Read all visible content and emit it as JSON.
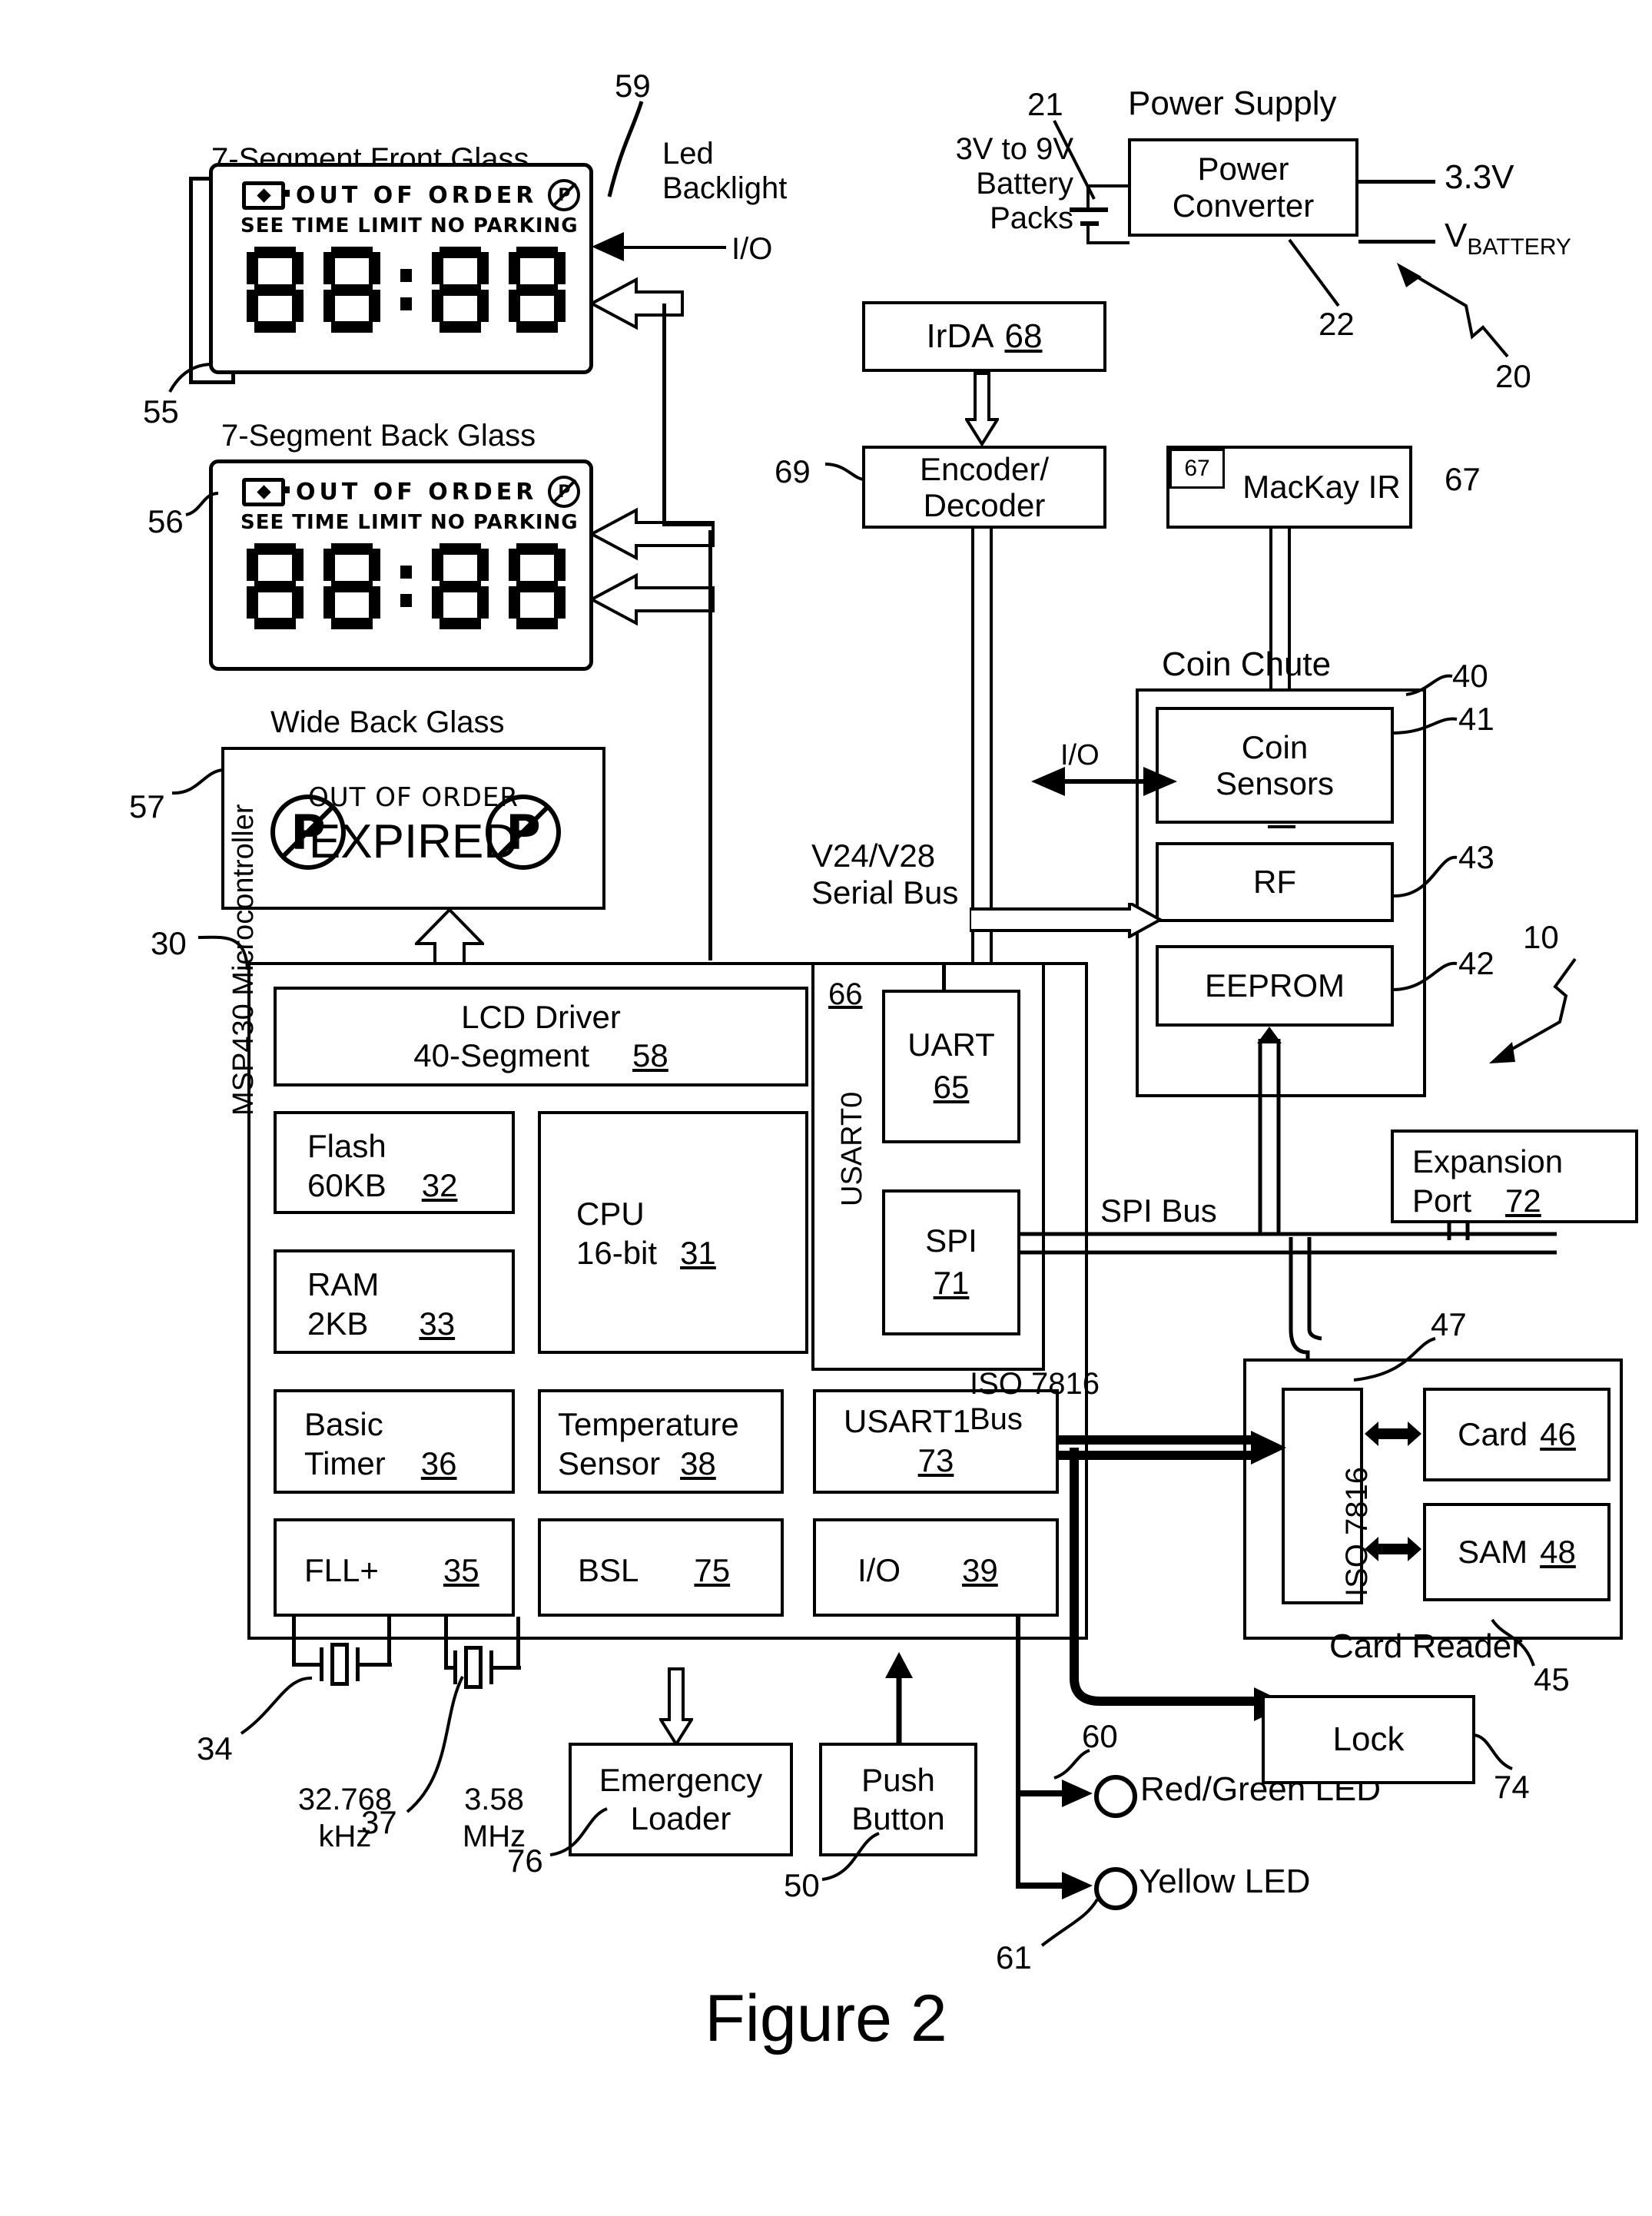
{
  "figure": {
    "caption": "Figure 2"
  },
  "displays": {
    "front_glass": {
      "title": "7-Segment Front Glass",
      "ref": "55",
      "line1": "OUT OF ORDER",
      "line2": "SEE TIME LIMIT   NO PARKING",
      "digits": "88:88",
      "battery_icon": "battery-icon",
      "no_parking_icon": "no-parking-icon"
    },
    "back_glass": {
      "title": "7-Segment Back Glass",
      "ref": "56",
      "line1": "OUT OF ORDER",
      "line2": "SEE TIME LIMIT   NO PARKING",
      "digits": "88:88"
    },
    "wide_back_glass": {
      "title": "Wide Back Glass",
      "ref": "57",
      "line1": "OUT OF ORDER",
      "line2": "EXPIRED"
    },
    "backlight": {
      "label": "Led\nBacklight",
      "ref": "59",
      "io": "I/O"
    }
  },
  "power": {
    "title": "Power Supply",
    "converter": "Power\nConverter",
    "battery_label": "3V to 9V\nBattery\nPacks",
    "battery_ref": "21",
    "converter_ref": "22",
    "system_ref": "20",
    "out1": "3.3V",
    "out2_v": "V",
    "out2_sub": "BATTERY"
  },
  "ir": {
    "irda": "IrDA",
    "irda_ref": "68",
    "encdec": "Encoder/\nDecoder",
    "encdec_ref": "69",
    "mackay": "MacKay IR",
    "mackay_ref_inner": "67",
    "mackay_ref_outer": "67"
  },
  "coin_chute": {
    "title": "Coin Chute",
    "ref": "40",
    "io": "I/O",
    "items": [
      {
        "label": "Coin\nSensors",
        "ref": "41"
      },
      {
        "label": "RF",
        "ref": "43"
      },
      {
        "label": "EEPROM",
        "ref": "42"
      }
    ],
    "system_ref": "10"
  },
  "buses": {
    "serial": "V24/V28\nSerial Bus",
    "spi": "SPI Bus",
    "iso": "ISO 7816\nBus"
  },
  "mcu": {
    "side_label": "MSP430 Microcontroller",
    "ref": "30",
    "lcd_driver": {
      "line1": "LCD Driver",
      "line2": "40-Segment",
      "ref": "58"
    },
    "blocks": [
      {
        "line1": "Flash",
        "line2": "60KB",
        "ref": "32"
      },
      {
        "line1": "CPU",
        "line2": "16-bit",
        "ref": "31"
      },
      {
        "line1": "RAM",
        "line2": "2KB",
        "ref": "33"
      },
      {
        "line1": "Basic",
        "line2": "Timer",
        "ref": "36"
      },
      {
        "line1": "Temperature",
        "line2": "Sensor",
        "ref": "38"
      },
      {
        "line1": "FLL+",
        "line2": "",
        "ref": "35"
      },
      {
        "line1": "BSL",
        "line2": "",
        "ref": "75"
      },
      {
        "line1": "I/O",
        "line2": "",
        "ref": "39"
      },
      {
        "line1": "USART1",
        "line2": "",
        "ref": "73"
      }
    ],
    "usart0": {
      "label": "USART0",
      "ref": "66",
      "uart": {
        "label": "UART",
        "ref": "65"
      },
      "spi": {
        "label": "SPI",
        "ref": "71"
      }
    }
  },
  "expansion": {
    "line1": "Expansion",
    "line2": "Port",
    "ref": "72"
  },
  "card_reader": {
    "title": "Card Reader",
    "ref": "45",
    "iso_label": "ISO 7816",
    "iso_ref": "47",
    "card": "Card",
    "card_ref": "46",
    "sam": "SAM",
    "sam_ref": "48"
  },
  "clocks": [
    {
      "line1": "32.768",
      "line2": "kHz",
      "ref": "34"
    },
    {
      "line1": "3.58",
      "line2": "MHz",
      "ref": "37"
    }
  ],
  "bottom": {
    "emergency_loader": "Emergency\nLoader",
    "emergency_ref": "76",
    "push_button": "Push\nButton",
    "push_ref": "50",
    "lock": "Lock",
    "lock_ref": "74",
    "led_rg": "Red/Green LED",
    "led_rg_ref": "60",
    "led_y": "Yellow LED",
    "led_y_ref": "61"
  }
}
